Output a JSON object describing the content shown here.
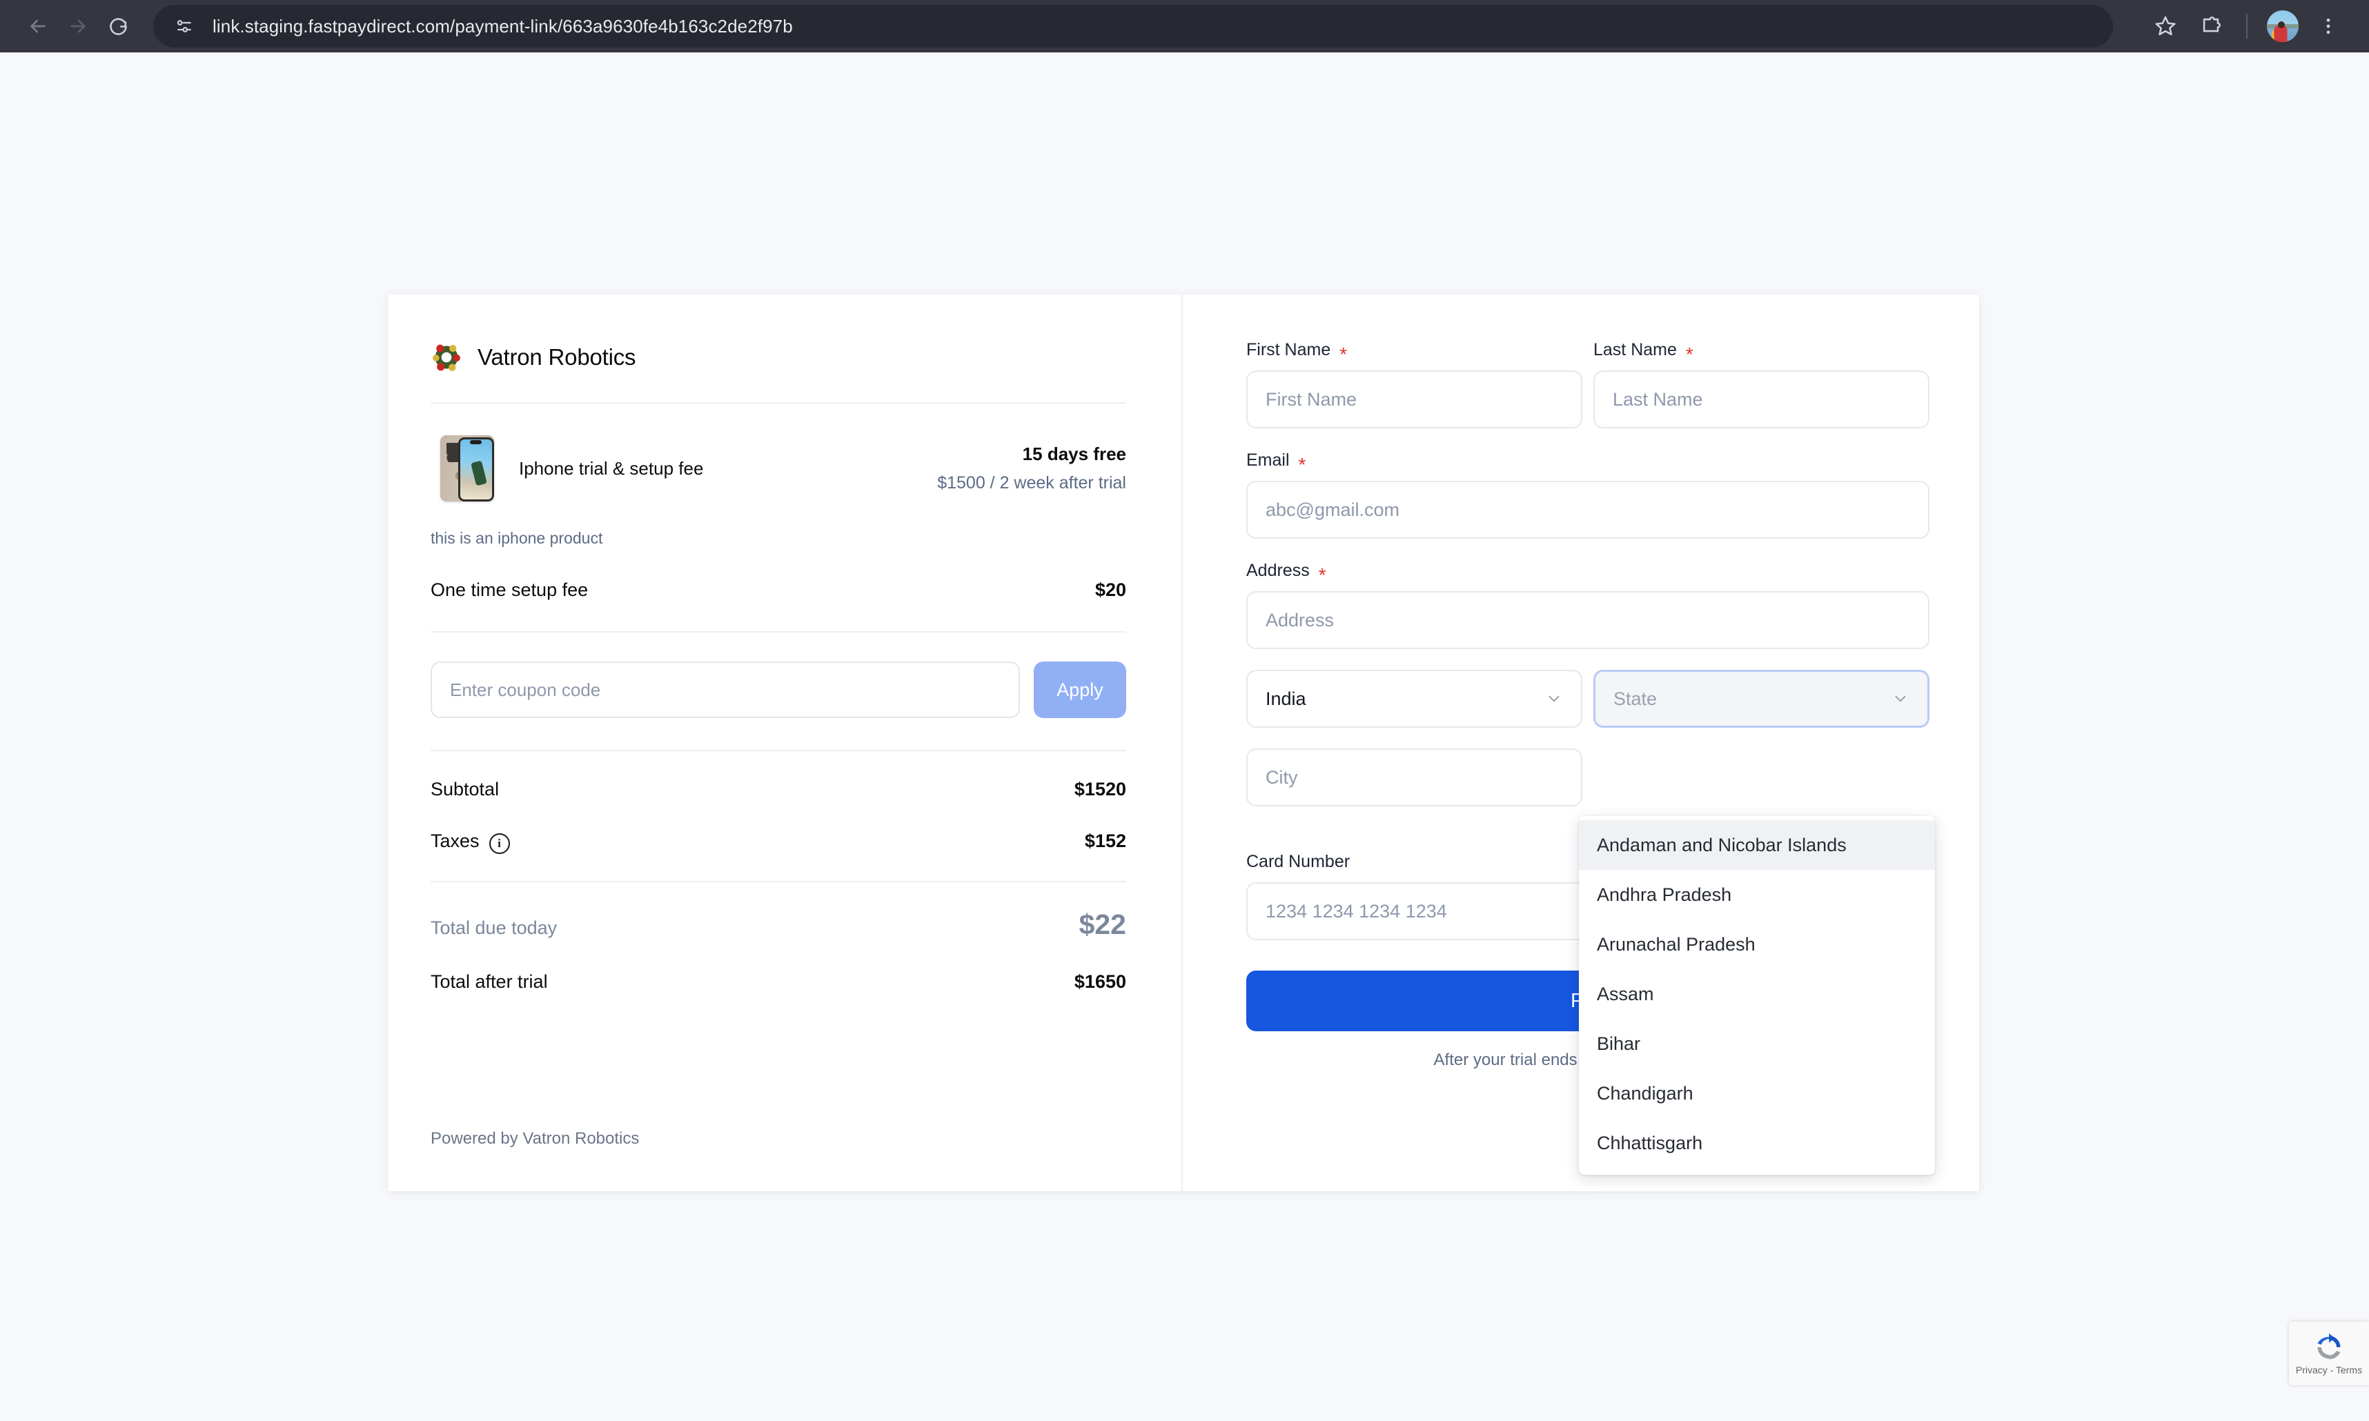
{
  "browser": {
    "url": "link.staging.fastpaydirect.com/payment-link/663a9630fe4b163c2de2f97b",
    "back_label": "Back",
    "forward_label": "Forward",
    "reload_label": "Reload",
    "bookmark_label": "Bookmark this tab",
    "extensions_label": "Extensions",
    "profile_label": "Profile",
    "menu_label": "Customize and control Google Chrome"
  },
  "summary": {
    "brand_name": "Vatron Robotics",
    "product": {
      "name": "Iphone trial & setup fee",
      "trial_text": "15 days free",
      "after_trial_text": "$1500 / 2 week after trial",
      "note": "this is an iphone product"
    },
    "setup_fee": {
      "label": "One time setup fee",
      "value": "$20"
    },
    "coupon": {
      "placeholder": "Enter coupon code",
      "value": "",
      "apply_label": "Apply"
    },
    "lines": [
      {
        "label": "Subtotal",
        "value": "$1520"
      },
      {
        "label": "Taxes",
        "value": "$152"
      }
    ],
    "total_due_today": {
      "label": "Total due today",
      "value": "$22"
    },
    "total_after_trial": {
      "label": "Total after trial",
      "value": "$1650"
    },
    "powered_by": "Powered by Vatron Robotics"
  },
  "form": {
    "first_name": {
      "label": "First Name",
      "required_mark": "*",
      "placeholder": "First Name",
      "value": ""
    },
    "last_name": {
      "label": "Last Name",
      "required_mark": "*",
      "placeholder": "Last Name",
      "value": ""
    },
    "email": {
      "label": "Email",
      "required_mark": "*",
      "placeholder": "abc@gmail.com",
      "value": ""
    },
    "address": {
      "label": "Address",
      "required_mark": "*",
      "placeholder": "Address",
      "value": ""
    },
    "country": {
      "selected": "India"
    },
    "state": {
      "placeholder": "State",
      "selected": ""
    },
    "city": {
      "placeholder": "City",
      "value": ""
    },
    "card_number": {
      "label": "Card Number",
      "placeholder": "1234 1234 1234 1234",
      "value": ""
    },
    "pay_button_label": "Pay",
    "trial_disclaimer": "After your trial ends, you will be charged $"
  },
  "state_dropdown": {
    "options": [
      "Andaman and Nicobar Islands",
      "Andhra Pradesh",
      "Arunachal Pradesh",
      "Assam",
      "Bihar",
      "Chandigarh",
      "Chhattisgarh"
    ],
    "highlighted_index": 0
  },
  "recaptcha": {
    "text": "Privacy - Terms"
  },
  "colors": {
    "chrome_bar": "#35363f",
    "omnibox": "#272831",
    "page_bg": "#f7f8fb",
    "card_bg": "#ffffff",
    "pay_button": "#1657e0",
    "apply_button": "#90aff5",
    "required_star": "#e0342c",
    "muted_text": "#5d6b85",
    "focus_border": "#b9caf5"
  }
}
